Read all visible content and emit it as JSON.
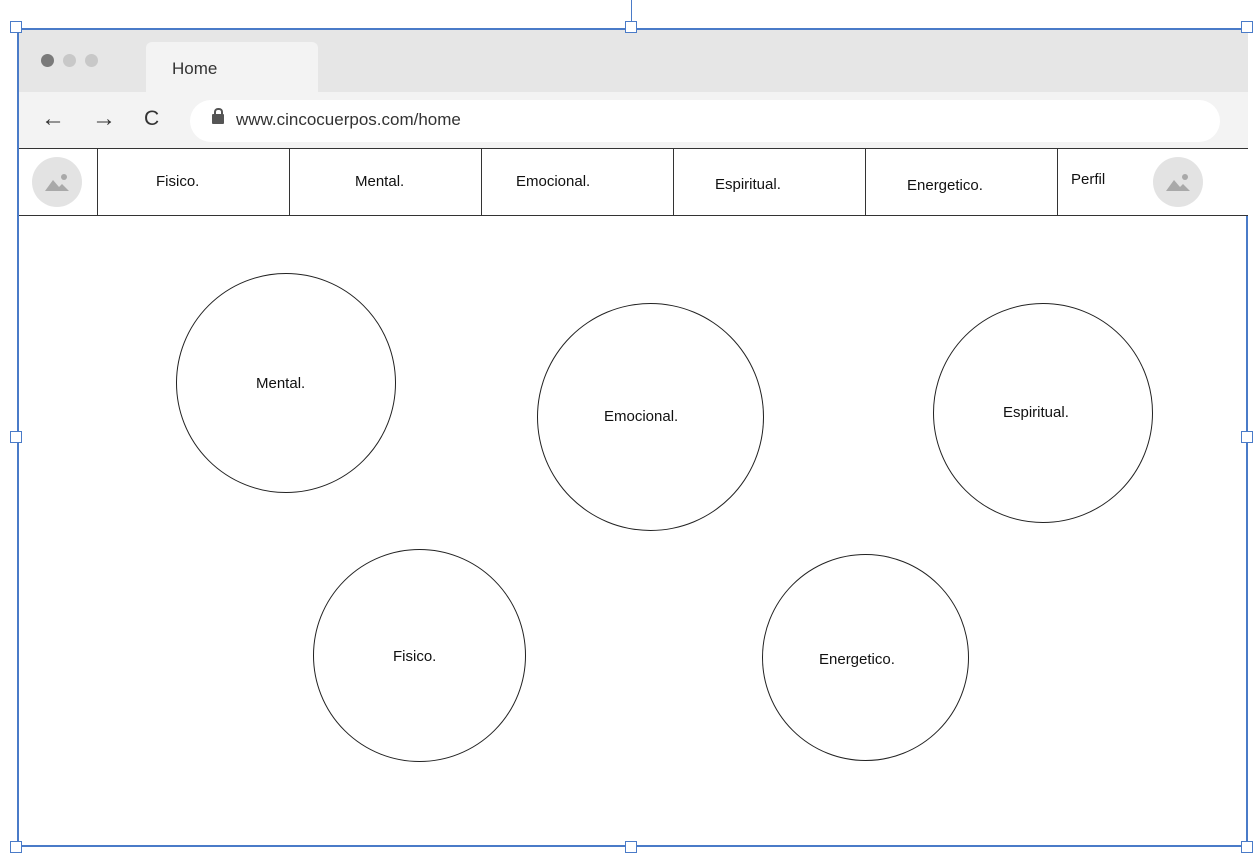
{
  "browser": {
    "tab_title": "Home",
    "url": "www.cincocuerpos.com/home",
    "back_glyph": "←",
    "forward_glyph": "→",
    "reload_glyph": "C"
  },
  "nav": {
    "items": [
      "Fisico.",
      "Mental.",
      "Emocional.",
      "Espiritual.",
      "Energetico."
    ],
    "profile_label": "Perfil",
    "logo_icon": "image-placeholder-icon",
    "profile_icon": "image-placeholder-icon"
  },
  "circles": {
    "mental": "Mental.",
    "emocional": "Emocional.",
    "espiritual": "Espiritual.",
    "fisico": "Fisico.",
    "energetico": "Energetico."
  },
  "colors": {
    "selection_border": "#4a7bc8",
    "titlebar": "#e6e6e6",
    "addressbar": "#f3f3f3"
  }
}
